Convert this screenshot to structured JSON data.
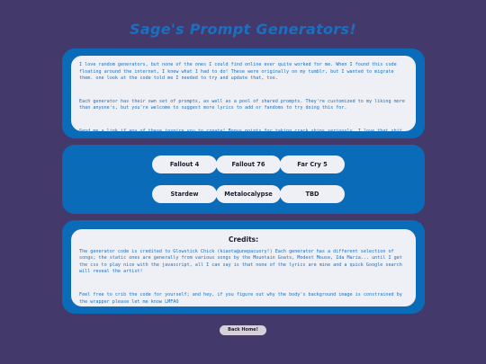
{
  "header": {
    "title": "Sage's Prompt Generators!"
  },
  "intro": {
    "paragraphs": [
      "I love random generators, but none of the ones I could find online ever quite worked for me. When I found this code floating around the internet, I knew what I had to do! These were originally on my tumblr, but I wanted to migrate them. one look at the code told me I needed to try and update that, too.",
      "Each generator has their own set of prompts, as well as a pool of shared prompts. They're customized to my liking more than anyone's, but you're welcome to suggest more lyrics to add or fandoms to try doing this for.",
      "Send me a link if any of these inspire you to create! Bonus points for taking crack ships seriously, I love that shit."
    ]
  },
  "generators": {
    "buttons": [
      "Fallout 4",
      "Fallout 76",
      "Far Cry 5",
      "Stardew",
      "Metalocalypse",
      "TBD"
    ]
  },
  "credits": {
    "title": "Credits:",
    "paragraphs": [
      "The generator code is credited to Glowstick Chick (kiaota@unepacuory!) Each generator has a different selection of songs; the static ones are generally from various songs by the Mountain Goats, Modest Mouse, Ida Maria... until I get the css to play nice with the javascript, all I can say is that none of the lyrics are mine and a quick Google search will reveal the artist!",
      "Feel free to crib the code for yourself; and hey, if you figure out why the body's background image is constrained by the wrapper please let me know LMFAO"
    ]
  },
  "footer": {
    "back_label": "Back Home!"
  }
}
